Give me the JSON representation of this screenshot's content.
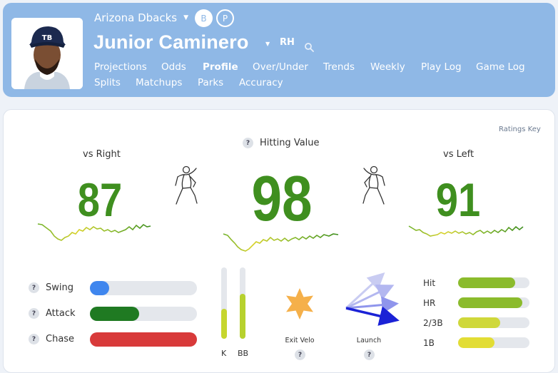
{
  "header": {
    "team": "Arizona Dbacks",
    "toggle_b": "B",
    "toggle_p": "P",
    "player_name": "Junior Caminero",
    "handedness": "RH",
    "nav": [
      "Projections",
      "Odds",
      "Profile",
      "Over/Under",
      "Trends",
      "Weekly",
      "Play Log",
      "Game Log",
      "Splits",
      "Matchups",
      "Parks",
      "Accuracy"
    ],
    "active_nav": "Profile"
  },
  "profile": {
    "ratings_key": "Ratings Key",
    "hitting_value_label": "Hitting Value",
    "hitting_value": "98",
    "vs_right_label": "vs Right",
    "vs_right": "87",
    "vs_left_label": "vs Left",
    "vs_left": "91",
    "help_mark": "?"
  },
  "discipline": [
    {
      "label": "Swing",
      "value": 0.18,
      "color": "#3f86ee"
    },
    {
      "label": "Attack",
      "value": 0.46,
      "color": "#1f7a22"
    },
    {
      "label": "Chase",
      "value": 1.0,
      "color": "#d83a3a"
    }
  ],
  "rates": [
    {
      "label": "K",
      "value": 0.42
    },
    {
      "label": "BB",
      "value": 0.63
    }
  ],
  "contact": {
    "exit_velo_label": "Exit Velo",
    "launch_label": "Launch"
  },
  "batted_ball": [
    {
      "label": "Hit",
      "value": 0.8,
      "color": "#8bbb2c"
    },
    {
      "label": "HR",
      "value": 0.9,
      "color": "#8bbb2c"
    },
    {
      "label": "2/3B",
      "value": 0.59,
      "color": "#cfd83a"
    },
    {
      "label": "1B",
      "value": 0.51,
      "color": "#e2dd35"
    }
  ],
  "colors": {
    "header_bg": "#8fb8e6",
    "rating_green": "#3f8f1f"
  }
}
